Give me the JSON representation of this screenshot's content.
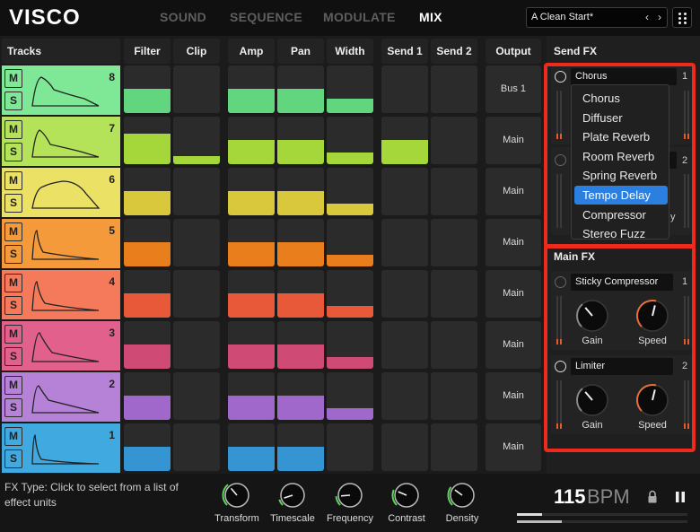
{
  "app": {
    "logo": "VISCO"
  },
  "nav": [
    {
      "label": "SOUND",
      "active": false
    },
    {
      "label": "SEQUENCE",
      "active": false
    },
    {
      "label": "MODULATE",
      "active": false
    },
    {
      "label": "MIX",
      "active": true
    }
  ],
  "preset": {
    "name": "A Clean Start*",
    "prev": "‹",
    "next": "›"
  },
  "columns": {
    "tracks": "Tracks",
    "filter": "Filter",
    "clip": "Clip",
    "amp": "Amp",
    "pan": "Pan",
    "width": "Width",
    "send1": "Send 1",
    "send2": "Send 2",
    "output": "Output"
  },
  "ms": {
    "mute": "M",
    "solo": "S"
  },
  "tracks": [
    {
      "number": "8",
      "color": "#7ee896",
      "bar": "#62d67e",
      "output": "Bus 1",
      "filter": 0.5,
      "clip": 0,
      "amp": 0.5,
      "pan": 0.5,
      "width": 0.3,
      "send1": 0,
      "send2": 0
    },
    {
      "number": "7",
      "color": "#b4e35a",
      "bar": "#a5d63a",
      "output": "Main",
      "filter": 0.65,
      "clip": 0.17,
      "amp": 0.5,
      "pan": 0.5,
      "width": 0.25,
      "send1": 0.5,
      "send2": 0
    },
    {
      "number": "6",
      "color": "#ebe164",
      "bar": "#d9c83c",
      "output": "Main",
      "filter": 0.5,
      "clip": 0,
      "amp": 0.5,
      "pan": 0.5,
      "width": 0.25,
      "send1": 0,
      "send2": 0
    },
    {
      "number": "5",
      "color": "#f59a3a",
      "bar": "#e87e1c",
      "output": "Main",
      "filter": 0.5,
      "clip": 0,
      "amp": 0.5,
      "pan": 0.5,
      "width": 0.25,
      "send1": 0,
      "send2": 0
    },
    {
      "number": "4",
      "color": "#f57a5c",
      "bar": "#e8593a",
      "output": "Main",
      "filter": 0.5,
      "clip": 0,
      "amp": 0.5,
      "pan": 0.5,
      "width": 0.25,
      "send1": 0,
      "send2": 0
    },
    {
      "number": "3",
      "color": "#e2608c",
      "bar": "#cf4a74",
      "output": "Main",
      "filter": 0.5,
      "clip": 0,
      "amp": 0.5,
      "pan": 0.5,
      "width": 0.25,
      "send1": 0,
      "send2": 0
    },
    {
      "number": "2",
      "color": "#b582d8",
      "bar": "#a168cc",
      "output": "Main",
      "filter": 0.5,
      "clip": 0,
      "amp": 0.5,
      "pan": 0.5,
      "width": 0.25,
      "send1": 0,
      "send2": 0
    },
    {
      "number": "1",
      "color": "#3fa9e0",
      "bar": "#3595d2",
      "output": "Main",
      "filter": 0.5,
      "clip": 0,
      "amp": 0.5,
      "pan": 0.5,
      "width": 0.0,
      "send1": 0,
      "send2": 0
    }
  ],
  "send_fx": {
    "title": "Send FX",
    "slot1": {
      "name": "Chorus",
      "number": "1"
    },
    "slot2": {
      "number": "2",
      "tail": "y"
    },
    "dropdown": [
      {
        "label": "Chorus",
        "selected": false
      },
      {
        "label": "Diffuser",
        "selected": false
      },
      {
        "label": "Plate Reverb",
        "selected": false
      },
      {
        "label": "Room Reverb",
        "selected": false
      },
      {
        "label": "Spring Reverb",
        "selected": false
      },
      {
        "label": "Tempo Delay",
        "selected": true
      },
      {
        "label": "Compressor",
        "selected": false
      },
      {
        "label": "Stereo Fuzz",
        "selected": false
      }
    ]
  },
  "main_fx": {
    "title": "Main FX",
    "slots": [
      {
        "name": "Sticky Compressor",
        "number": "1",
        "knob1": "Gain",
        "knob2": "Speed"
      },
      {
        "name": "Limiter",
        "number": "2",
        "knob1": "Gain",
        "knob2": "Speed"
      }
    ]
  },
  "status": {
    "text": "FX Type: Click to select from a list of effect units"
  },
  "macros": [
    {
      "label": "Transform",
      "value": 0.35
    },
    {
      "label": "Timescale",
      "value": 0.1
    },
    {
      "label": "Frequency",
      "value": 0.15
    },
    {
      "label": "Contrast",
      "value": 0.25
    },
    {
      "label": "Density",
      "value": 0.3
    }
  ],
  "tempo": {
    "value": "115",
    "unit": "BPM"
  }
}
